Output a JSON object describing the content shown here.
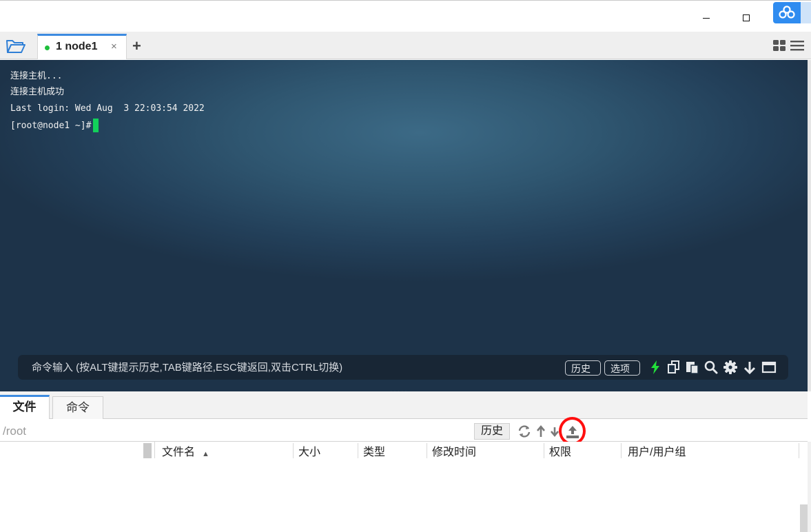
{
  "window": {
    "minimize_icon": "minimize-icon",
    "maximize_icon": "maximize-icon",
    "cloud_icon": "cloud-sync-icon"
  },
  "tabs": {
    "folder_icon": "folder-open-icon",
    "active": {
      "label": "1 node1",
      "status": "connected",
      "status_color": "#1fbf3c",
      "close": "×"
    },
    "add_label": "+",
    "layout_icon": "grid-layout-icon",
    "menu_icon": "hamburger-menu-icon",
    "accent_color": "#3d8be0"
  },
  "terminal": {
    "lines": [
      "连接主机...",
      "连接主机成功",
      "Last login: Wed Aug  3 22:03:54 2022",
      "[root@node1 ~]#"
    ],
    "cursor_color": "#12d05a"
  },
  "command_bar": {
    "placeholder": "命令输入 (按ALT键提示历史,TAB键路径,ESC键返回,双击CTRL切换)",
    "history_label": "历史",
    "options_label": "选项",
    "icons": [
      "lightning-icon",
      "copy-icon",
      "paste-icon",
      "search-icon",
      "gear-icon",
      "arrow-down-icon",
      "window-icon"
    ]
  },
  "lower_tabs": {
    "files_label": "文件",
    "commands_label": "命令"
  },
  "path_bar": {
    "path": "/root",
    "history_label": "历史",
    "icons": [
      "refresh-icon",
      "arrow-up-icon",
      "download-icon",
      "upload-icon"
    ]
  },
  "file_list": {
    "columns": [
      "文件名",
      "大小",
      "类型",
      "修改时间",
      "权限",
      "用户/用户组"
    ],
    "sort_indicator": "▲"
  }
}
